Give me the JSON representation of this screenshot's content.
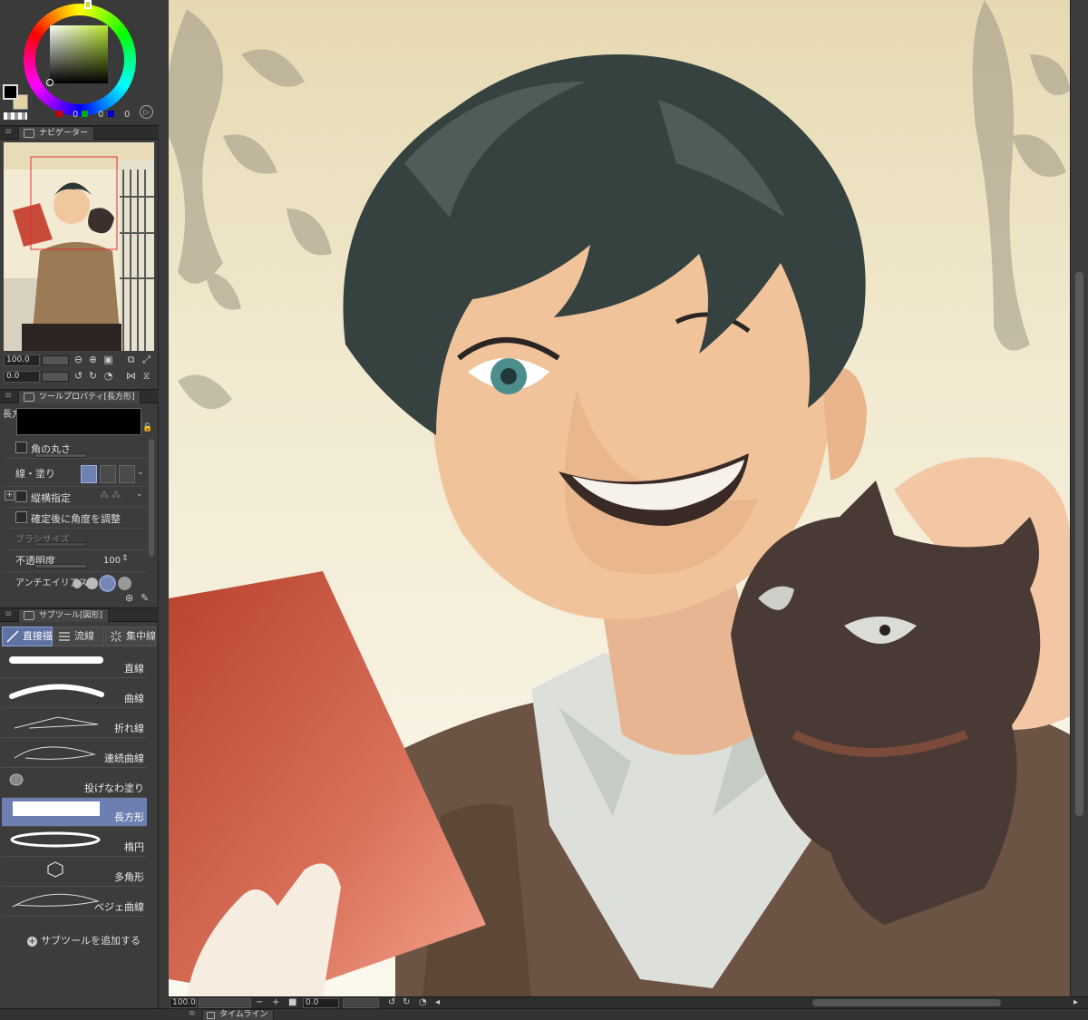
{
  "color": {
    "fg_color": "#000000",
    "bg_color": "#e3d4a8",
    "r": "0",
    "g": "0",
    "b": "0"
  },
  "navigator": {
    "tab_label": "ナビゲーター",
    "zoom_value": "100.0",
    "rotate_value": "0.0"
  },
  "tool_property": {
    "tab_label": "ツールプロパティ[長方形]",
    "tool_name": "長方形",
    "rounded_corner": "角の丸さ",
    "line_fill": "線・塗り",
    "aspect": "縦横指定",
    "adjust_angle": "確定後に角度を調整",
    "brush_size": "ブラシサイズ",
    "opacity": "不透明度",
    "opacity_value": "100",
    "antialias": "アンチエイリアス"
  },
  "subtool": {
    "tab_label": "サブツール[図形]",
    "groups": [
      {
        "label": "直接描"
      },
      {
        "label": "流線"
      },
      {
        "label": "集中線"
      }
    ],
    "items": [
      {
        "label": "直線"
      },
      {
        "label": "曲線"
      },
      {
        "label": "折れ線"
      },
      {
        "label": "連続曲線"
      },
      {
        "label": "投げなわ塗り"
      },
      {
        "label": "長方形"
      },
      {
        "label": "楕円"
      },
      {
        "label": "多角形"
      },
      {
        "label": "ベジェ曲線"
      }
    ],
    "add_label": "サブツールを追加する"
  },
  "status": {
    "zoom": "100.0",
    "angle": "0.0"
  },
  "timeline": {
    "tab_label": "タイムライン"
  }
}
